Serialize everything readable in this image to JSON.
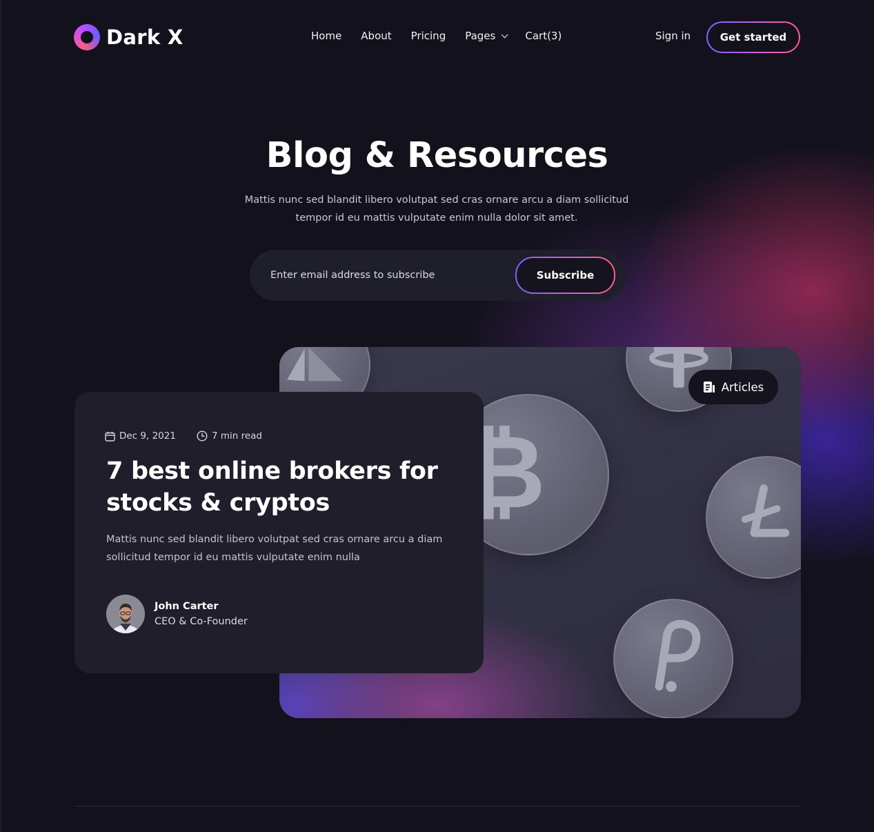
{
  "header": {
    "logo_text": "Dark X",
    "nav": [
      {
        "label": "Home"
      },
      {
        "label": "About"
      },
      {
        "label": "Pricing"
      },
      {
        "label": "Pages",
        "has_dropdown": true
      },
      {
        "label": "Cart(3)"
      }
    ],
    "sign_in": "Sign in",
    "cta": "Get started"
  },
  "hero": {
    "title": "Blog & Resources",
    "subtitle": "Mattis nunc sed blandit libero volutpat sed cras ornare arcu a diam sollicitud tempor id eu mattis vulputate enim nulla dolor sit amet.",
    "email_placeholder": "Enter email address to subscribe",
    "subscribe_label": "Subscribe"
  },
  "featured": {
    "tag": "Articles",
    "date": "Dec 9, 2021",
    "read_time": "7 min read",
    "title": "7 best online brokers for stocks & cryptos",
    "excerpt": "Mattis nunc sed blandit libero volutpat sed cras ornare arcu a diam sollicitud tempor id eu mattis vulputate enim nulla",
    "author": {
      "name": "John Carter",
      "role": "CEO & Co-Founder"
    }
  },
  "colors": {
    "background": "#13121c",
    "card": "#1f1e2a",
    "accent_gradient": [
      "#7a63ff",
      "#c75fe0",
      "#ff5b8d"
    ]
  }
}
